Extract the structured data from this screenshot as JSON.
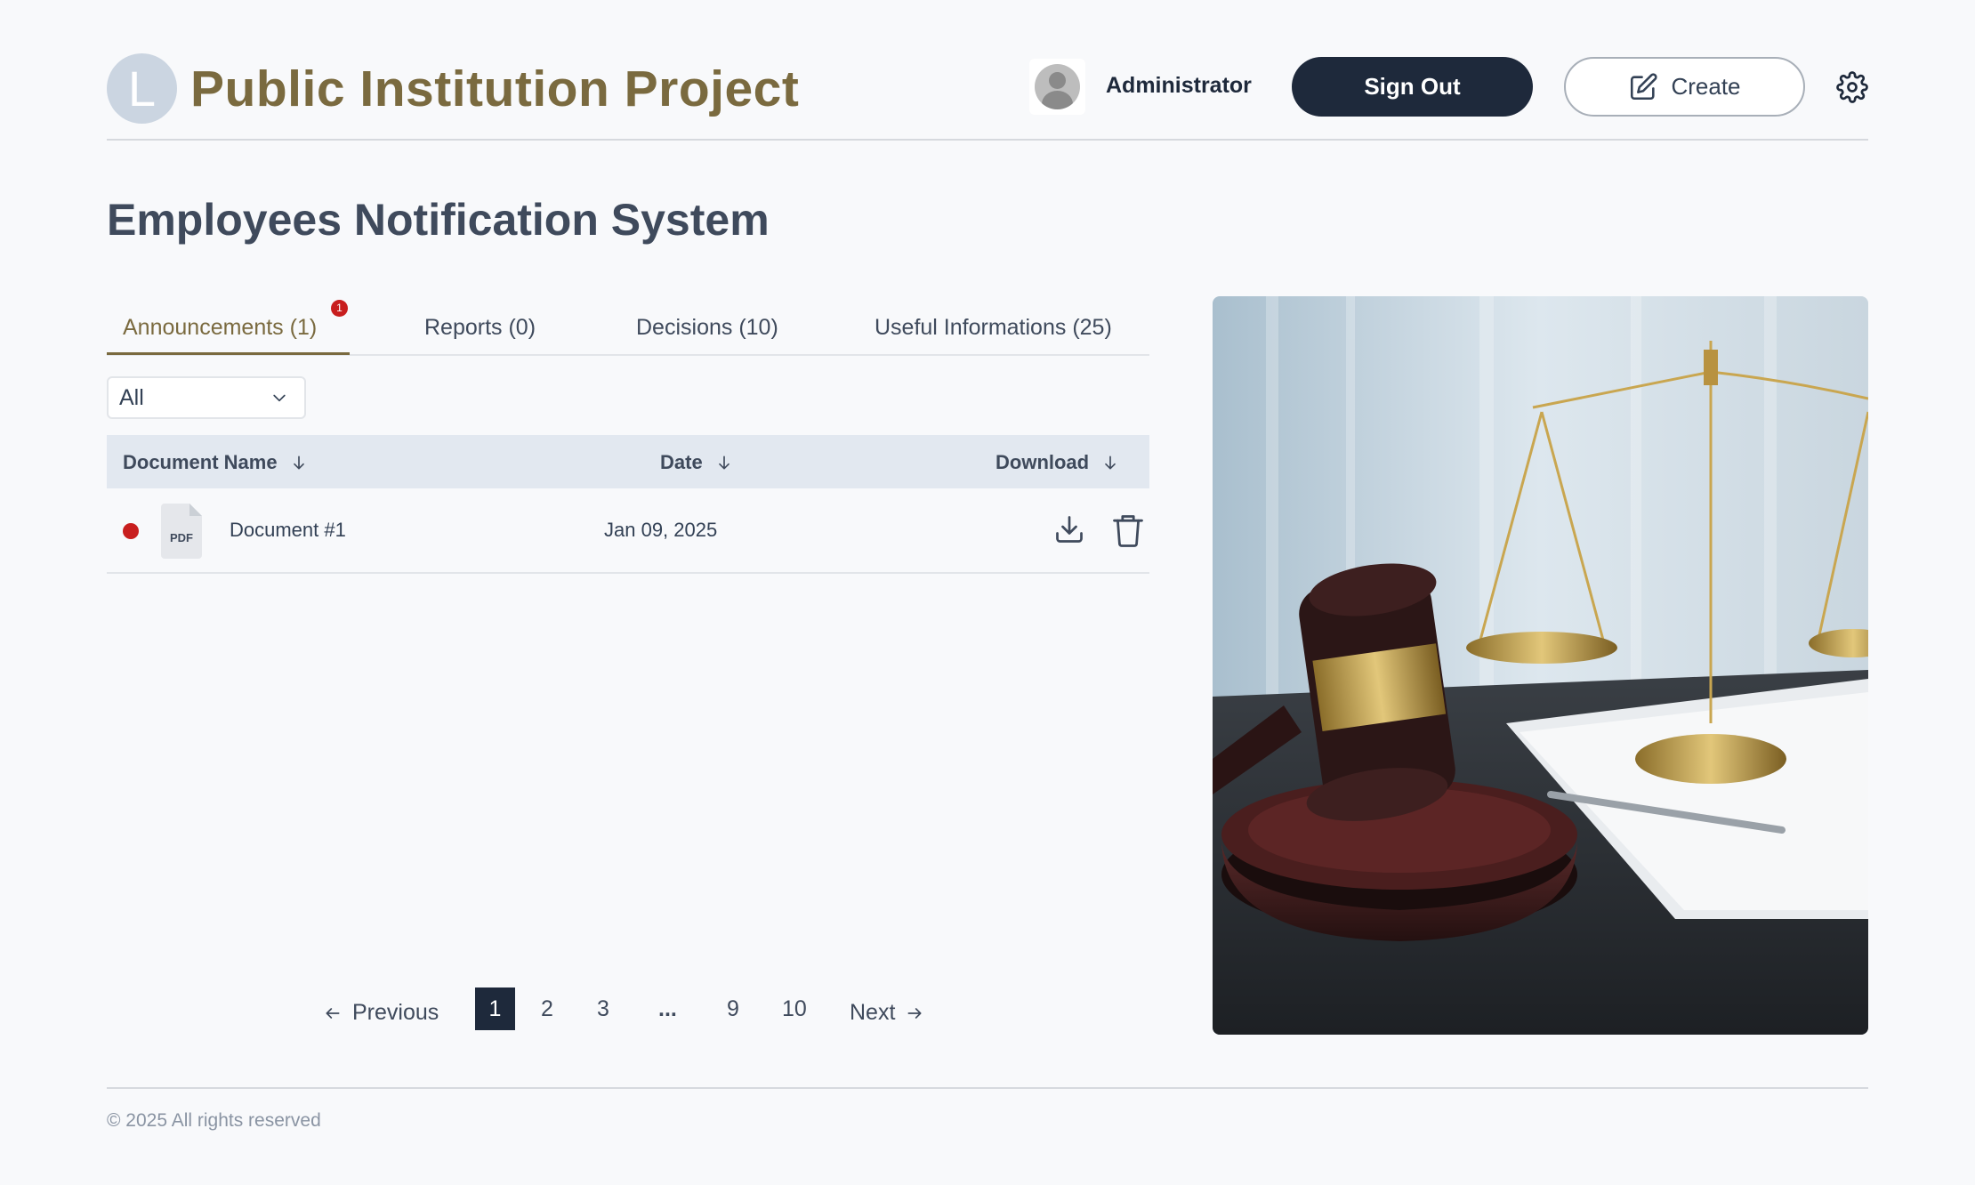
{
  "header": {
    "logo_letter": "L",
    "app_title": "Public Institution Project",
    "user_name": "Administrator",
    "sign_out_label": "Sign Out",
    "create_label": "Create"
  },
  "page_title": "Employees Notification System",
  "tabs": [
    {
      "label": "Announcements (1)",
      "active": true,
      "badge": "1"
    },
    {
      "label": "Reports (0)",
      "active": false
    },
    {
      "label": "Decisions (10)",
      "active": false
    },
    {
      "label": "Useful Informations (25)",
      "active": false
    }
  ],
  "filter": {
    "selected": "All"
  },
  "table": {
    "columns": [
      "Document Name",
      "Date",
      "Download"
    ],
    "rows": [
      {
        "file_type": "PDF",
        "name": "Document #1",
        "date": "Jan 09, 2025",
        "unread": true
      }
    ]
  },
  "pagination": {
    "previous_label": "Previous",
    "next_label": "Next",
    "pages": [
      "1",
      "2",
      "3",
      "...",
      "9",
      "10"
    ],
    "current": "1"
  },
  "footer": {
    "copyright": "© 2025 All rights reserved"
  },
  "icons": {
    "create": "edit-icon",
    "settings": "gear-icon",
    "sort": "arrow-down-icon",
    "download": "download-icon",
    "delete": "trash-icon",
    "file": "pdf-file-icon"
  },
  "colors": {
    "brand": "#7a6a3f",
    "primary_dark": "#1e293b",
    "unread_dot": "#c81e1e",
    "table_header": "#e2e8f0",
    "background": "#f8f9fb"
  }
}
